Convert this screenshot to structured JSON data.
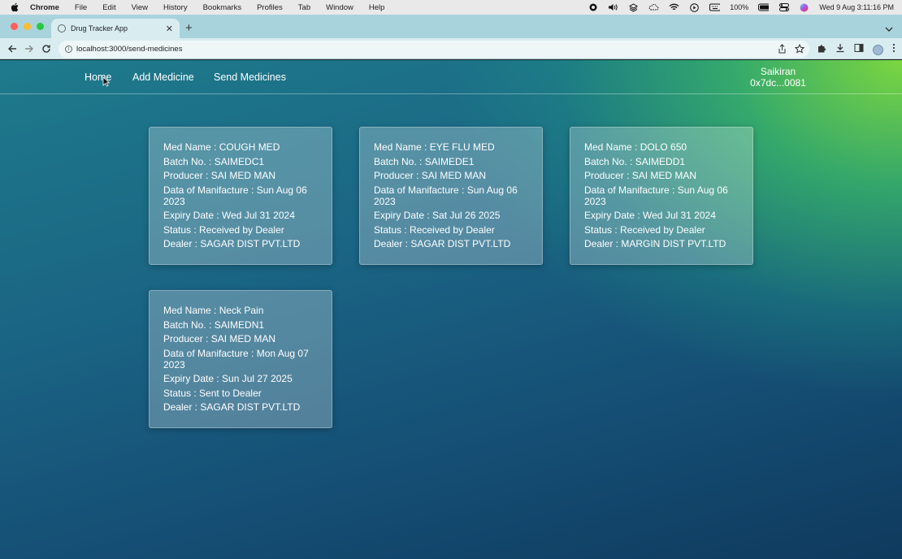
{
  "menubar": {
    "app": "Chrome",
    "items": [
      "File",
      "Edit",
      "View",
      "History",
      "Bookmarks",
      "Profiles",
      "Tab",
      "Window",
      "Help"
    ],
    "battery": "100%",
    "clock": "Wed 9 Aug  3:11:16 PM"
  },
  "browser": {
    "tab_title": "Drug Tracker App",
    "url": "localhost:3000/send-medicines"
  },
  "nav": {
    "links": [
      "Home",
      "Add Medicine",
      "Send Medicines"
    ],
    "account_name": "Saikiran",
    "account_address": "0x7dc...0081"
  },
  "medicines": [
    {
      "name": "Med Name : COUGH MED",
      "batch": "Batch No. : SAIMEDC1",
      "producer": "Producer : SAI MED MAN",
      "manufacture": "Data of Manifacture : Sun Aug 06 2023",
      "expiry": "Expiry Date : Wed Jul 31 2024",
      "status": "Status : Received by Dealer",
      "dealer": "Dealer : SAGAR DIST PVT.LTD"
    },
    {
      "name": "Med Name : EYE FLU MED",
      "batch": "Batch No. : SAIMEDE1",
      "producer": "Producer : SAI MED MAN",
      "manufacture": "Data of Manifacture : Sun Aug 06 2023",
      "expiry": "Expiry Date : Sat Jul 26 2025",
      "status": "Status : Received by Dealer",
      "dealer": "Dealer : SAGAR DIST PVT.LTD"
    },
    {
      "name": "Med Name : DOLO 650",
      "batch": "Batch No. : SAIMEDD1",
      "producer": "Producer : SAI MED MAN",
      "manufacture": "Data of Manifacture : Sun Aug 06 2023",
      "expiry": "Expiry Date : Wed Jul 31 2024",
      "status": "Status : Received by Dealer",
      "dealer": "Dealer : MARGIN DIST PVT.LTD"
    },
    {
      "name": "Med Name : Neck Pain",
      "batch": "Batch No. : SAIMEDN1",
      "producer": "Producer : SAI MED MAN",
      "manufacture": "Data of Manifacture : Mon Aug 07 2023",
      "expiry": "Expiry Date : Sun Jul 27 2025",
      "status": "Status : Sent to Dealer",
      "dealer": "Dealer : SAGAR DIST PVT.LTD"
    }
  ]
}
